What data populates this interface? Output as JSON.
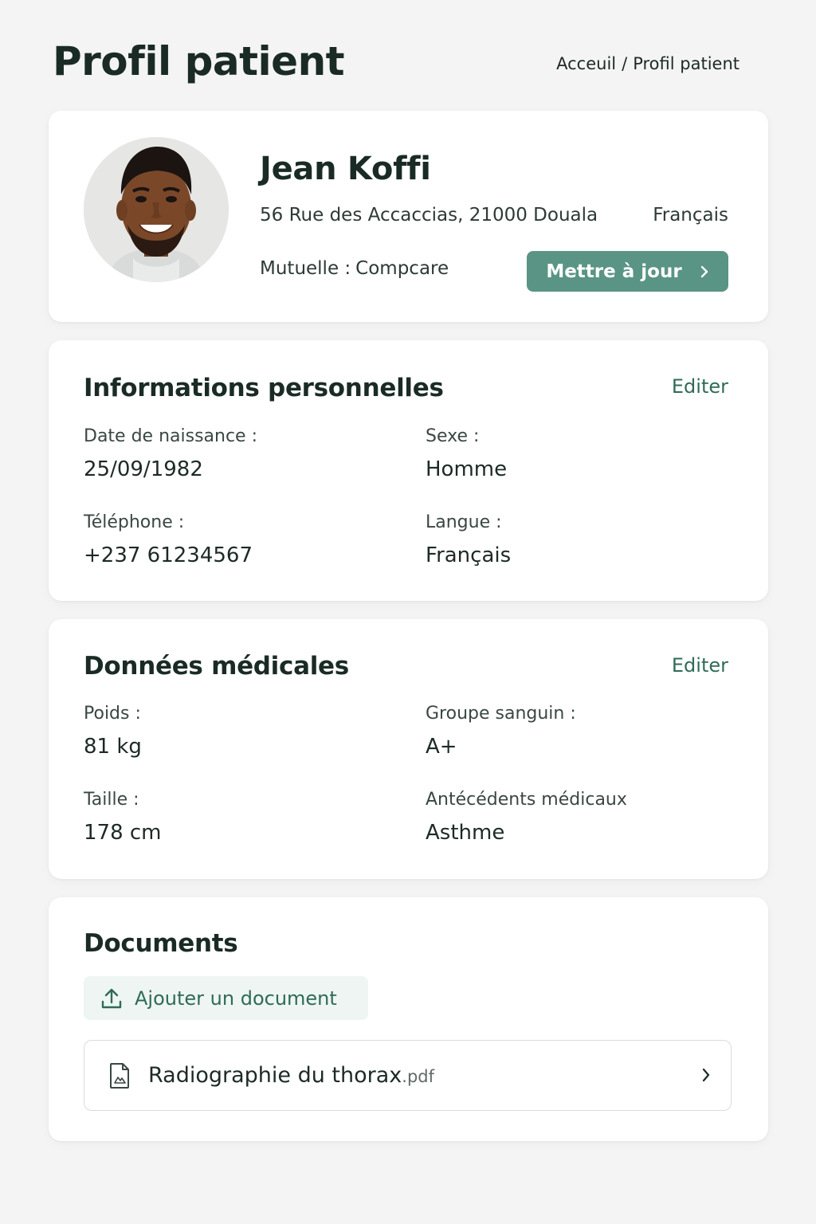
{
  "header": {
    "title": "Profil patient",
    "breadcrumb": [
      {
        "label": "Acceuil"
      },
      {
        "label": "Profil patient"
      }
    ],
    "breadcrumb_separator": "/"
  },
  "profile": {
    "name": "Jean Koffi",
    "address": "56 Rue des Accaccias, 21000 Douala",
    "language": "Français",
    "mutuelle_label": "Mutuelle :",
    "mutuelle_value": "Compcare",
    "update_button": "Mettre à jour",
    "avatar_icon": "user-avatar"
  },
  "personal_info": {
    "title": "Informations personnelles",
    "edit_label": "Editer",
    "fields": [
      {
        "label": "Date de naissance :",
        "value": "25/09/1982"
      },
      {
        "label": "Sexe :",
        "value": "Homme"
      },
      {
        "label": "Téléphone :",
        "value": "+237 61234567"
      },
      {
        "label": "Langue :",
        "value": "Français"
      }
    ]
  },
  "medical": {
    "title": "Données médicales",
    "edit_label": "Editer",
    "fields": [
      {
        "label": "Poids :",
        "value": "81 kg"
      },
      {
        "label": "Groupe sanguin :",
        "value": "A+"
      },
      {
        "label": "Taille :",
        "value": "178 cm"
      },
      {
        "label": "Antécédents médicaux",
        "value": "Asthme"
      }
    ]
  },
  "documents": {
    "title": "Documents",
    "add_label": "Ajouter un document",
    "items": [
      {
        "name": "Radiographie du thorax",
        "ext": ".pdf"
      }
    ]
  },
  "colors": {
    "accent": "#5a9484",
    "accent_text": "#2f6b58",
    "background": "#f3f4f3",
    "card": "#ffffff"
  }
}
